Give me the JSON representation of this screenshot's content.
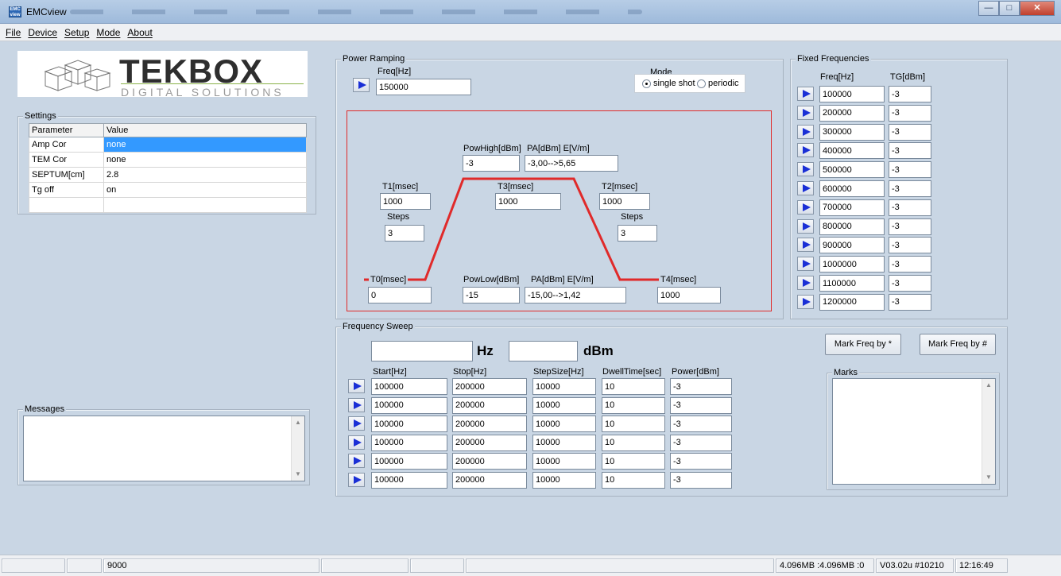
{
  "window": {
    "title": "EMCview",
    "app_icon_text": "EMC view"
  },
  "menu": [
    "File",
    "Device",
    "Setup",
    "Mode",
    "About"
  ],
  "logo": {
    "main": "TEKBOX",
    "sub": "DIGITAL SOLUTIONS"
  },
  "settings": {
    "title": "Settings",
    "headers": [
      "Parameter",
      "Value"
    ],
    "rows": [
      {
        "param": "Amp Cor",
        "value": "none"
      },
      {
        "param": "TEM Cor",
        "value": "none"
      },
      {
        "param": "SEPTUM[cm]",
        "value": "2.8"
      },
      {
        "param": "Tg off",
        "value": "on"
      }
    ]
  },
  "messages": {
    "title": "Messages"
  },
  "power_ramping": {
    "title": "Power Ramping",
    "freq_label": "Freq[Hz]",
    "freq_value": "150000",
    "mode_label": "Mode",
    "mode_single": "single shot",
    "mode_periodic": "periodic",
    "pow_high_label": "PowHigh[dBm]",
    "pow_high_value": "-3",
    "pa_high_label": "PA[dBm]  E[V/m]",
    "pa_high_value": "-3,00-->5,65",
    "t1_label": "T1[msec]",
    "t1_value": "1000",
    "t3_label": "T3[msec]",
    "t3_value": "1000",
    "t2_label": "T2[msec]",
    "t2_value": "1000",
    "steps_label": "Steps",
    "steps_left_value": "3",
    "steps_right_value": "3",
    "t0_label": "T0[msec]",
    "t0_value": "0",
    "pow_low_label": "PowLow[dBm]",
    "pow_low_value": "-15",
    "pa_low_label": "PA[dBm]  E[V/m]",
    "pa_low_value": "-15,00-->1,42",
    "t4_label": "T4[msec]",
    "t4_value": "1000"
  },
  "fixed_frequencies": {
    "title": "Fixed Frequencies",
    "freq_header": "Freq[Hz]",
    "tg_header": "TG[dBm]",
    "rows": [
      {
        "freq": "100000",
        "tg": "-3"
      },
      {
        "freq": "200000",
        "tg": "-3"
      },
      {
        "freq": "300000",
        "tg": "-3"
      },
      {
        "freq": "400000",
        "tg": "-3"
      },
      {
        "freq": "500000",
        "tg": "-3"
      },
      {
        "freq": "600000",
        "tg": "-3"
      },
      {
        "freq": "700000",
        "tg": "-3"
      },
      {
        "freq": "800000",
        "tg": "-3"
      },
      {
        "freq": "900000",
        "tg": "-3"
      },
      {
        "freq": "1000000",
        "tg": "-3"
      },
      {
        "freq": "1100000",
        "tg": "-3"
      },
      {
        "freq": "1200000",
        "tg": "-3"
      }
    ]
  },
  "frequency_sweep": {
    "title": "Frequency Sweep",
    "hz_value": "",
    "hz_unit": "Hz",
    "dbm_value": "",
    "dbm_unit": "dBm",
    "headers": [
      "Start[Hz]",
      "Stop[Hz]",
      "StepSize[Hz]",
      "DwellTime[sec]",
      "Power[dBm]"
    ],
    "rows": [
      {
        "start": "100000",
        "stop": "200000",
        "step": "10000",
        "dwell": "10",
        "power": "-3"
      },
      {
        "start": "100000",
        "stop": "200000",
        "step": "10000",
        "dwell": "10",
        "power": "-3"
      },
      {
        "start": "100000",
        "stop": "200000",
        "step": "10000",
        "dwell": "10",
        "power": "-3"
      },
      {
        "start": "100000",
        "stop": "200000",
        "step": "10000",
        "dwell": "10",
        "power": "-3"
      },
      {
        "start": "100000",
        "stop": "200000",
        "step": "10000",
        "dwell": "10",
        "power": "-3"
      },
      {
        "start": "100000",
        "stop": "200000",
        "step": "10000",
        "dwell": "10",
        "power": "-3"
      }
    ],
    "mark_star_label": "Mark Freq by *",
    "mark_hash_label": "Mark Freq by #",
    "marks_title": "Marks"
  },
  "statusbar": {
    "value": "9000",
    "memory": "4.096MB :4.096MB :0",
    "version": "V03.02u #10210",
    "time": "12:16:49"
  },
  "colors": {
    "ramp": "#e02a2a",
    "play_arrow": "#1a2fd6",
    "selection": "#3399ff"
  }
}
